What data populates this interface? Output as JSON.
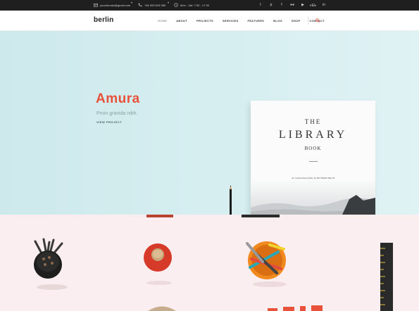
{
  "topbar": {
    "email": "yourdomain@gmail.com",
    "phone": "+84 905 815 589",
    "hours": "Mon - Sat: 7:30 - 17:30",
    "language": "EN",
    "social_icons": [
      "twitter-icon",
      "pinterest-icon",
      "facebook-icon",
      "flickr-icon",
      "youtube-icon",
      "instagram-icon",
      "linkedin-icon"
    ]
  },
  "header": {
    "logo": "berlin",
    "nav": [
      "HOME",
      "ABOUT",
      "PROJECTS",
      "SERVICES",
      "FEATURES",
      "BLOG",
      "SHOP",
      "CONTACT"
    ],
    "active_nav": "HOME",
    "search_icon": "search-icon"
  },
  "hero": {
    "title": "Amura",
    "subtitle": "Proin gravida nibh.",
    "link": "VIEW PROJECT",
    "book": {
      "line1": "THE",
      "line2": "LIBRARY",
      "line3": "BOOK",
      "byline": "An inspirational fable by RICHARD BACH"
    }
  },
  "colors": {
    "accent": "#e8513a",
    "topbar": "#1f1f1f",
    "hero_bg": "#d6eef0",
    "lower_bg": "#fbeef0"
  }
}
